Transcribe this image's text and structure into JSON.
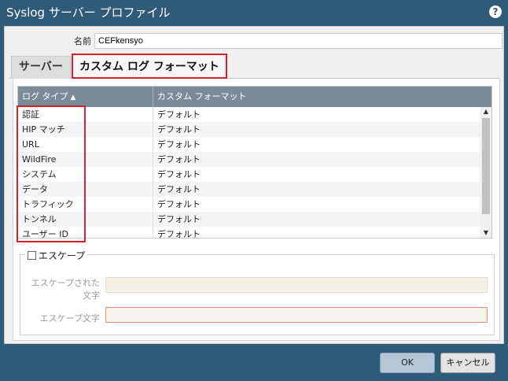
{
  "window": {
    "title": "Syslog サーバー プロファイル",
    "help": "?"
  },
  "name": {
    "label": "名前",
    "value": "CEFkensyo"
  },
  "tabs": {
    "server": "サーバー",
    "custom_format": "カスタム ログ フォーマット"
  },
  "grid": {
    "col_log_type": "ログ タイプ",
    "col_custom_format": "カスタム フォーマット",
    "sort_indicator": "▲",
    "rows": [
      {
        "log_type": "認証",
        "format": "デフォルト"
      },
      {
        "log_type": "HIP マッチ",
        "format": "デフォルト"
      },
      {
        "log_type": "URL",
        "format": "デフォルト"
      },
      {
        "log_type": "WildFire",
        "format": "デフォルト"
      },
      {
        "log_type": "システム",
        "format": "デフォルト"
      },
      {
        "log_type": "データ",
        "format": "デフォルト"
      },
      {
        "log_type": "トラフィック",
        "format": "デフォルト"
      },
      {
        "log_type": "トンネル",
        "format": "デフォルト"
      },
      {
        "log_type": "ユーザー ID",
        "format": "デフォルト"
      }
    ]
  },
  "escape": {
    "legend": "エスケープ",
    "escaped_chars_label": "エスケープされた文字",
    "escape_char_label": "エスケープ文字",
    "escaped_chars_value": "",
    "escape_char_value": ""
  },
  "buttons": {
    "ok": "OK",
    "cancel": "キャンセル"
  },
  "colors": {
    "titlebar": "#2e5b7a",
    "highlight": "#d9212b",
    "grid_header": "#7a8c98"
  }
}
